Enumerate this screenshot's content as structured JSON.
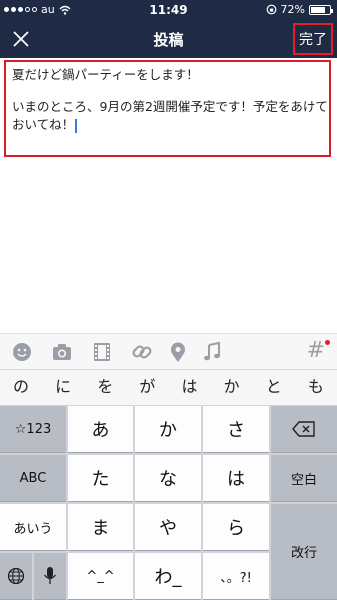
{
  "status": {
    "carrier": "au",
    "time": "11:49",
    "battery": "72%",
    "battery_level": 0.72
  },
  "nav": {
    "title": "投稿",
    "done_label": "完了",
    "close_icon": "close-icon"
  },
  "editor": {
    "line1": "夏だけど鍋パーティーをします！",
    "line2": "いまのところ、9月の第2週開催予定です！予定をあけて",
    "line3": "おいてね！"
  },
  "toolbar": {
    "icons": [
      "emoji-icon",
      "camera-icon",
      "video-icon",
      "link-icon",
      "location-icon",
      "music-icon",
      "hashtag-icon"
    ],
    "hash_symbol": "#"
  },
  "suggestions": [
    "の",
    "に",
    "を",
    "が",
    "は",
    "か",
    "と",
    "も"
  ],
  "keyboard": {
    "row1": [
      "☆123",
      "あ",
      "か",
      "さ",
      "⌫"
    ],
    "row2": [
      "ABC",
      "た",
      "な",
      "は",
      "空白"
    ],
    "row3": [
      "あいう",
      "ま",
      "や",
      "ら",
      "改行"
    ],
    "row4": [
      "🌐",
      "🎤",
      "^_^",
      "わ_",
      "、。?!"
    ]
  },
  "colors": {
    "nav_bg": "#1f2a44",
    "highlight_border": "#d81e2a",
    "caret": "#2f7be8"
  }
}
